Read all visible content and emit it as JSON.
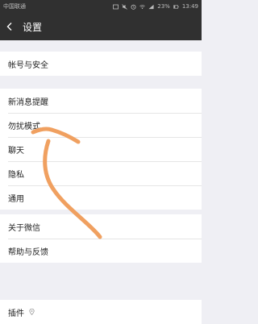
{
  "status_bar": {
    "carrier": "中国联通",
    "battery": "23%",
    "time": "13:49",
    "icons": [
      "image-icon",
      "mute-icon",
      "alarm-icon",
      "wifi-icon",
      "signal-icon",
      "battery-icon"
    ]
  },
  "header": {
    "title": "设置",
    "back_icon": "chevron-left-icon"
  },
  "sections": [
    {
      "items": [
        {
          "label": "帐号与安全"
        }
      ]
    },
    {
      "items": [
        {
          "label": "新消息提醒"
        },
        {
          "label": "勿扰模式"
        },
        {
          "label": "聊天"
        },
        {
          "label": "隐私"
        },
        {
          "label": "通用"
        }
      ]
    },
    {
      "items": [
        {
          "label": "关于微信"
        },
        {
          "label": "帮助与反馈"
        }
      ]
    },
    {
      "items": [
        {
          "label": "插件",
          "icon": "location-pin-icon"
        }
      ]
    }
  ],
  "annotation": {
    "color": "#f0a060",
    "icon": "hand-drawn-arrow"
  }
}
